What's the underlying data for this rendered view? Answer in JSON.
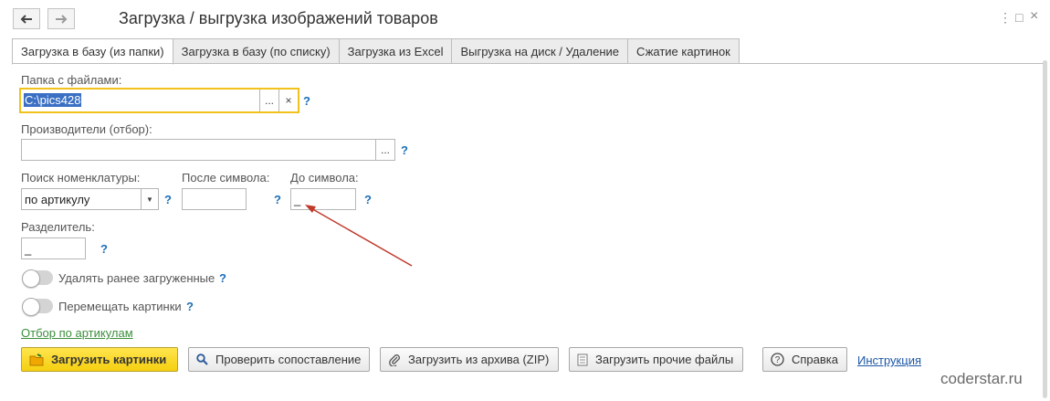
{
  "window": {
    "title": "Загрузка / выгрузка изображений товаров",
    "controls": [
      "⋮",
      "□",
      "×"
    ]
  },
  "nav": {
    "back": "back-arrow-icon",
    "forward": "forward-arrow-icon"
  },
  "tabs": [
    "Загрузка в базу (из папки)",
    "Загрузка в базу (по списку)",
    "Загрузка из Excel",
    "Выгрузка на диск / Удаление",
    "Сжатие картинок"
  ],
  "form": {
    "folder_label": "Папка с файлами:",
    "folder_value": "C:\\pics428",
    "manufacturers_label": "Производители (отбор):",
    "manufacturers_value": "",
    "search_label": "Поиск номенклатуры:",
    "search_value": "по артикулу",
    "after_label": "После символа:",
    "after_value": "",
    "before_label": "До символа:",
    "before_value": "_",
    "separator_label": "Разделитель:",
    "separator_value": "_",
    "toggle_delete_label": "Удалять ранее загруженные",
    "toggle_move_label": "Перемещать картинки",
    "filter_link": "Отбор по артикулам",
    "help_mark": "?",
    "ellipsis": "...",
    "clear": "×"
  },
  "buttons": {
    "load": "Загрузить картинки",
    "check": "Проверить сопоставление",
    "zip": "Загрузить из архива (ZIP)",
    "other": "Загрузить прочие файлы",
    "help": "Справка",
    "instruction": "Инструкция"
  },
  "watermark": "coderstar.ru",
  "colors": {
    "accent": "#f3c11b",
    "primary_button": "#f5cf10",
    "link": "#1b57a5",
    "annotation_arrow": "#c0392b"
  }
}
